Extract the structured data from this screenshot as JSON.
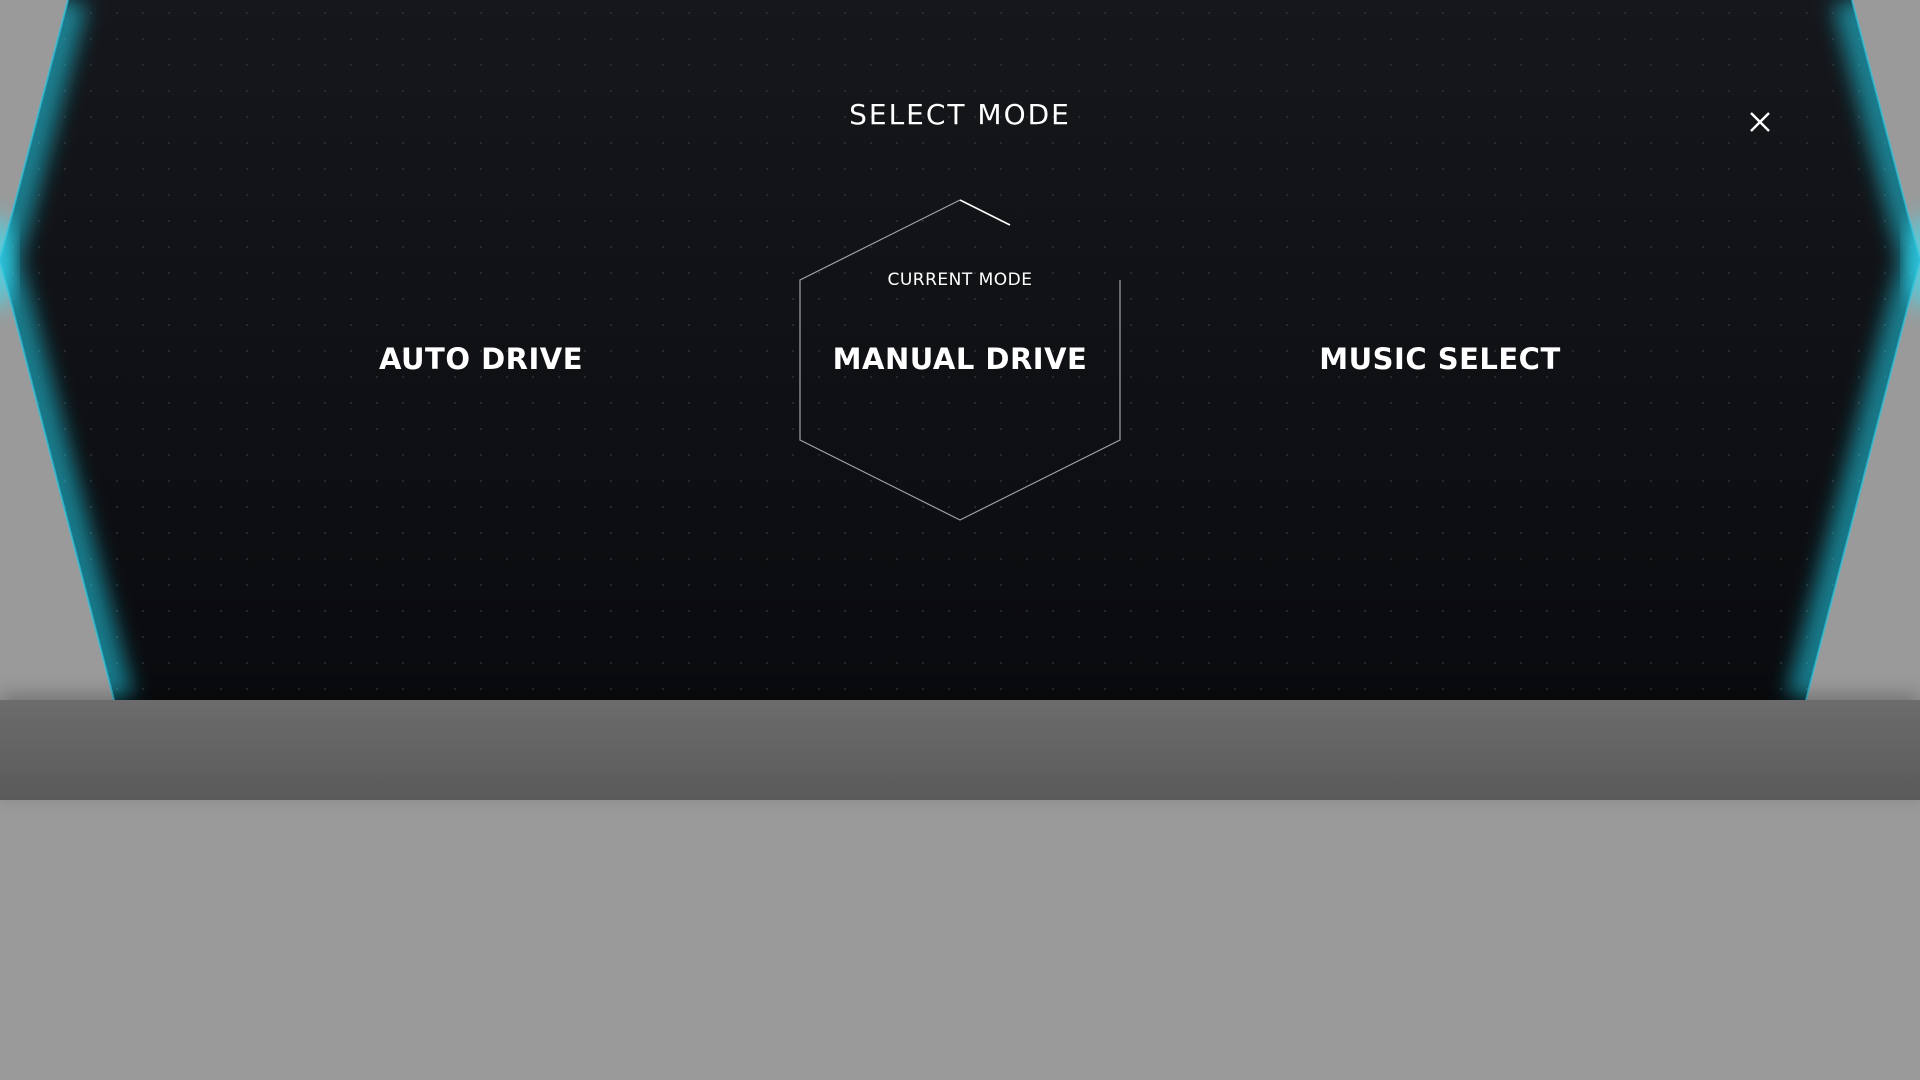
{
  "dialog": {
    "title": "SELECT MODE",
    "close_icon": "close-icon"
  },
  "modes": {
    "current_label": "CURRENT MODE",
    "items": [
      {
        "label": "AUTO DRIVE",
        "selected": false
      },
      {
        "label": "MANUAL DRIVE",
        "selected": true
      },
      {
        "label": "MUSIC SELECT",
        "selected": false
      }
    ]
  },
  "colors": {
    "panel_background": "#0e1014",
    "edge_glow": "#1fd6f0",
    "page_background": "#9a9a9a",
    "bottom_bar": "#636363",
    "text": "#ffffff"
  }
}
